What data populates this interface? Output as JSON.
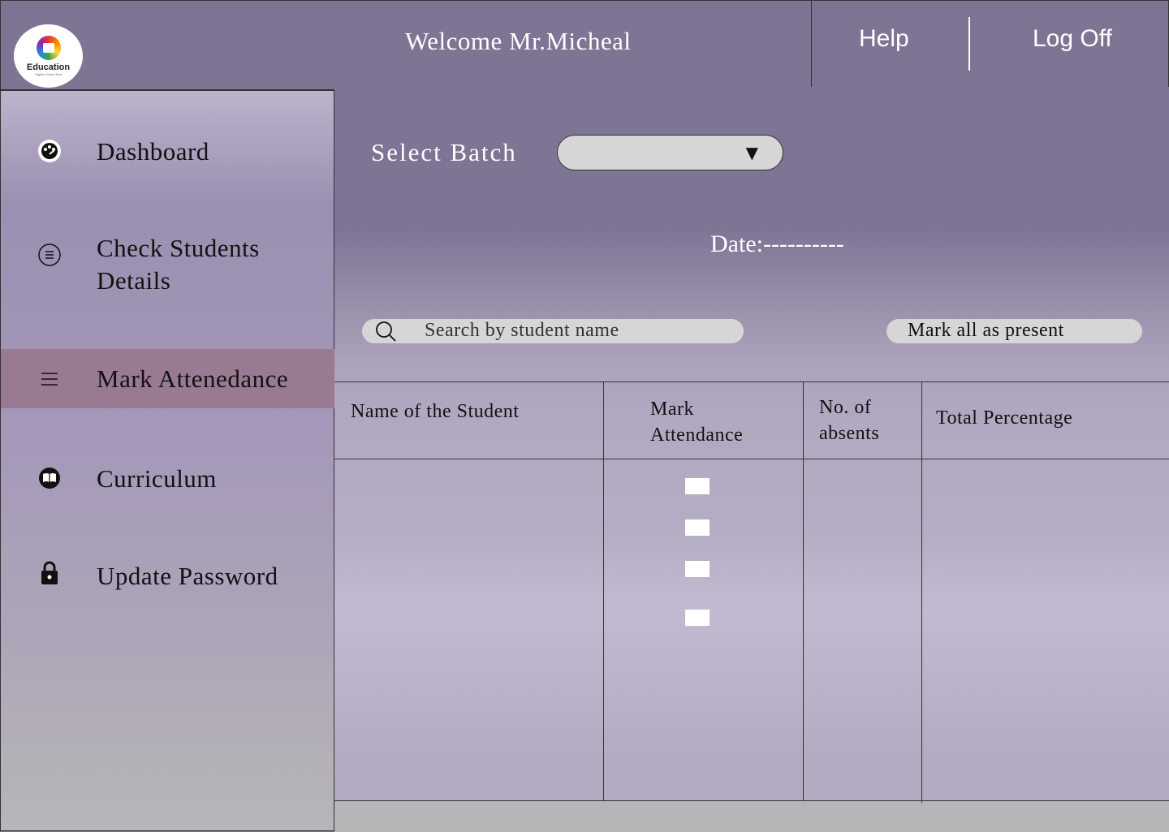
{
  "header": {
    "logo": {
      "name": "Education",
      "tagline": "Tagline Goes Here"
    },
    "welcome": "Welcome Mr.Micheal",
    "help": "Help",
    "logoff": "Log Off"
  },
  "sidebar": {
    "items": [
      {
        "label": "Dashboard",
        "icon": "dashboard-icon",
        "active": false
      },
      {
        "label": "Check Students",
        "label2": "Details",
        "icon": "list-circle-icon",
        "active": false
      },
      {
        "label": "Mark Attenedance",
        "icon": "menu-icon",
        "active": true
      },
      {
        "label": "Curriculum",
        "icon": "book-icon",
        "active": false
      },
      {
        "label": "Update Password",
        "icon": "lock-icon",
        "active": false
      }
    ]
  },
  "main": {
    "batch_label": "Select Batch",
    "batch_value": "",
    "batch_arrow": "▼",
    "date": "Date:----------",
    "search_placeholder": "Search by student name",
    "mark_all": "Mark all as present",
    "table": {
      "headers": [
        "Name of the Student",
        "Mark",
        "Attendance",
        "No. of",
        "absents",
        "Total Percentage"
      ],
      "checkboxes": [
        false,
        false,
        false,
        false
      ]
    }
  },
  "colors": {
    "header_bg": "#7e7595",
    "active_item": "#987b93",
    "input_bg": "#d6d6d6"
  }
}
